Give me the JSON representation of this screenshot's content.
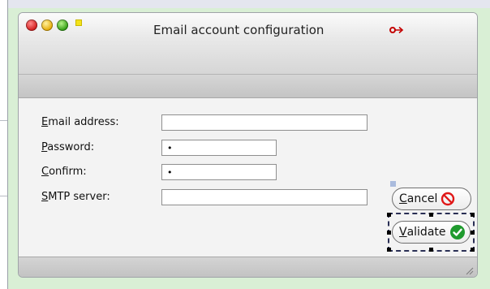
{
  "window": {
    "title": "Email account configuration"
  },
  "form": {
    "email": {
      "label_acc": "E",
      "label_rest": "mail address:",
      "value": ""
    },
    "password": {
      "label_acc": "P",
      "label_rest": "assword:",
      "value": "•"
    },
    "confirm": {
      "label_acc": "C",
      "label_rest": "onfirm:",
      "value": "•"
    },
    "smtp": {
      "label_acc": "S",
      "label_rest": "MTP server:",
      "value": ""
    }
  },
  "buttons": {
    "cancel": {
      "acc": "C",
      "rest": "ancel"
    },
    "validate": {
      "acc": "V",
      "rest": "alidate"
    }
  },
  "colors": {
    "background": "#d9efd5",
    "cancel_icon": "#e01818",
    "validate_icon": "#1f9a2e"
  }
}
